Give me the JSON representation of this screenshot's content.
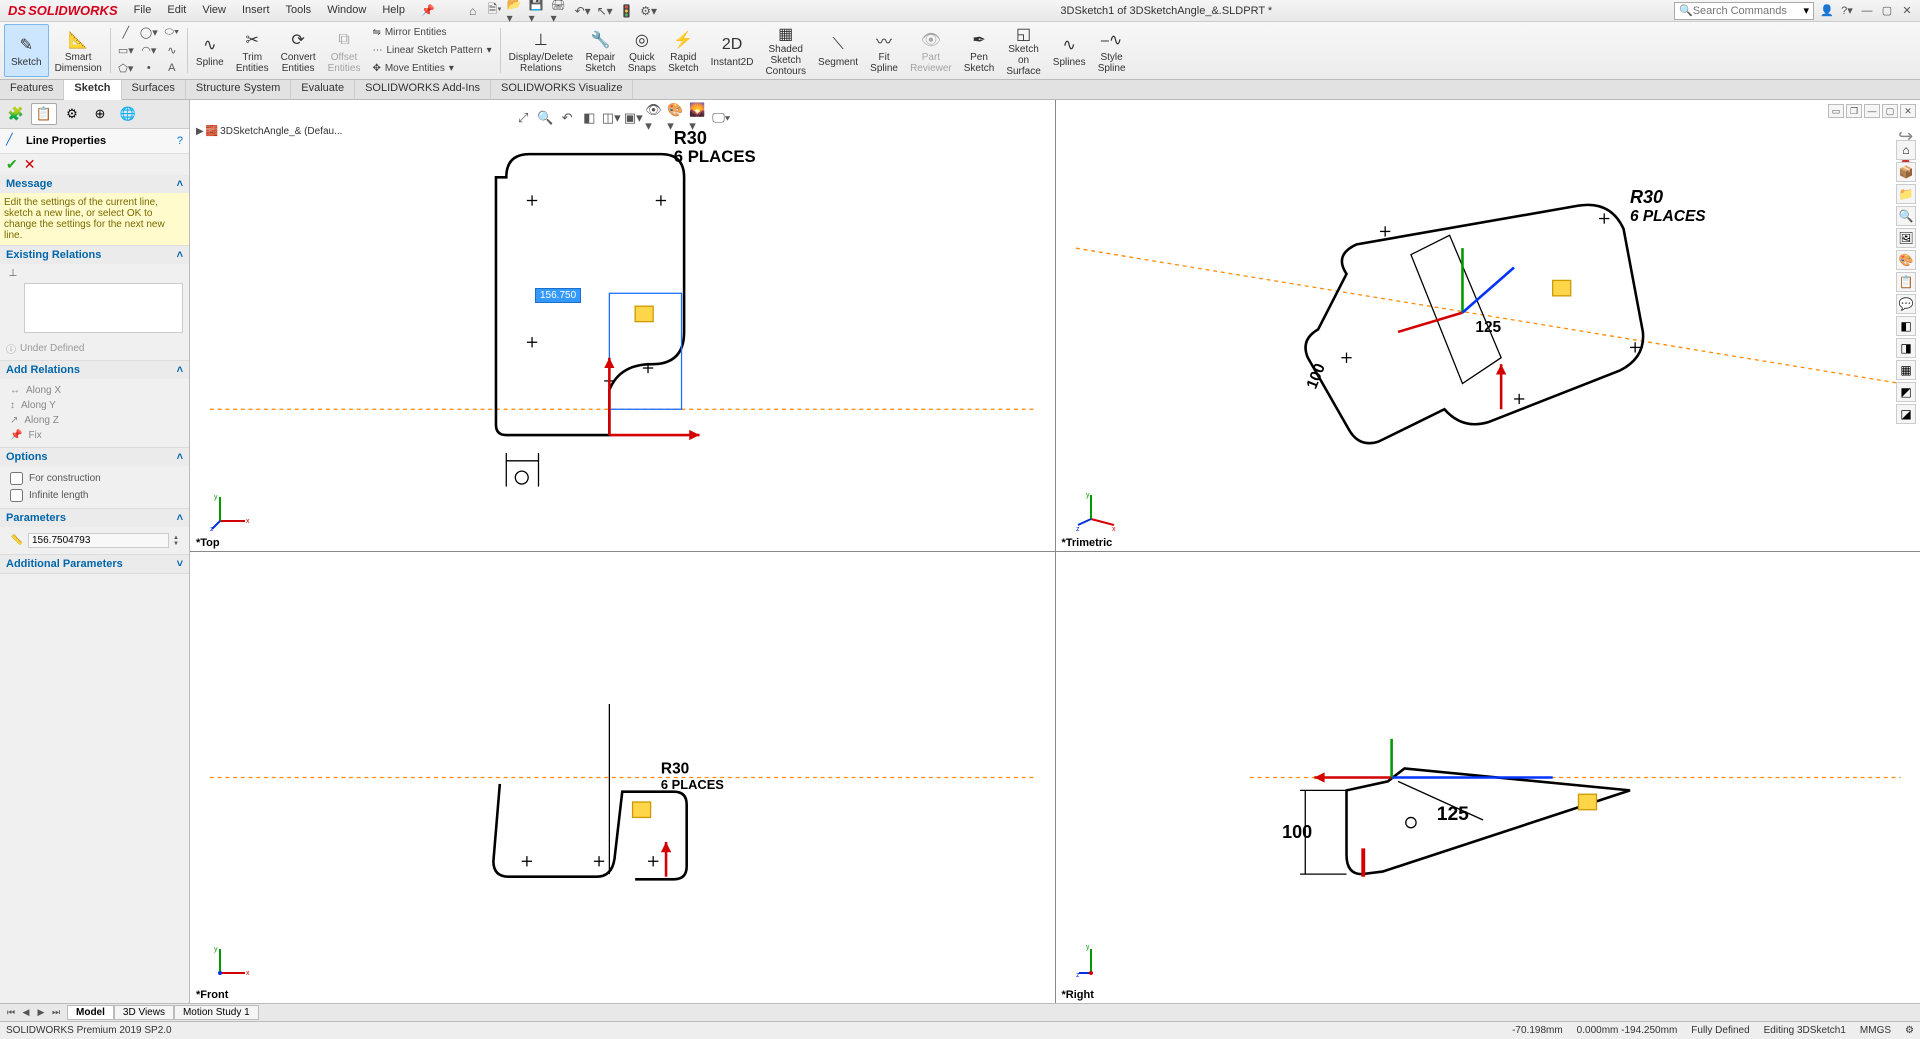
{
  "title": "3DSketch1 of 3DSketchAngle_&.SLDPRT *",
  "logo": "SOLIDWORKS",
  "menu": [
    "File",
    "Edit",
    "View",
    "Insert",
    "Tools",
    "Window",
    "Help"
  ],
  "search_placeholder": "Search Commands",
  "ribbon": {
    "sketch": "Sketch",
    "smart_dim": "Smart\nDimension",
    "spline": "Spline",
    "trim": "Trim\nEntities",
    "convert": "Convert\nEntities",
    "offset": "Offset\nEntities",
    "mirror": "Mirror Entities",
    "linear": "Linear Sketch Pattern",
    "move": "Move Entities",
    "disp_del": "Display/Delete\nRelations",
    "repair": "Repair\nSketch",
    "quick": "Quick\nSnaps",
    "rapid": "Rapid\nSketch",
    "instant2d": "Instant2D",
    "shaded": "Shaded\nSketch\nContours",
    "segment": "Segment",
    "fit_spline": "Fit\nSpline",
    "part_rev": "Part\nReviewer",
    "pen": "Pen\nSketch",
    "sketch_surf": "Sketch\non\nSurface",
    "splines": "Splines",
    "style_spline": "Style\nSpline"
  },
  "tabs": [
    "Features",
    "Sketch",
    "Surfaces",
    "Structure System",
    "Evaluate",
    "SOLIDWORKS Add-Ins",
    "SOLIDWORKS Visualize"
  ],
  "active_tab": "Sketch",
  "prop": {
    "title": "Line Properties",
    "msg_hd": "Message",
    "msg": "Edit the settings of the current line, sketch a new line, or select OK to change the settings for the next new line.",
    "exrel_hd": "Existing Relations",
    "under": "Under Defined",
    "addrel_hd": "Add Relations",
    "rel_alongx": "Along X",
    "rel_alongy": "Along Y",
    "rel_alongz": "Along Z",
    "rel_fix": "Fix",
    "opt_hd": "Options",
    "opt_construction": "For construction",
    "opt_infinite": "Infinite length",
    "param_hd": "Parameters",
    "param_value": "156.7504793",
    "addl_hd": "Additional Parameters"
  },
  "views": {
    "top": "*Top",
    "tri": "*Trimetric",
    "front": "*Front",
    "right": "*Right"
  },
  "dim_edit": "156.750",
  "annot": {
    "r30": "R30",
    "places": "6 PLACES",
    "d125": "125",
    "d100": "100"
  },
  "tree_item": "3DSketchAngle_&  (Defau...",
  "bottom_tabs": [
    "Model",
    "3D Views",
    "Motion Study 1"
  ],
  "status": {
    "left": "SOLIDWORKS Premium 2019 SP2.0",
    "coord": "-70.198mm",
    "coord2": "0.000mm -194.250mm",
    "defined": "Fully Defined",
    "editing": "Editing 3DSketch1",
    "units": "MMGS"
  }
}
